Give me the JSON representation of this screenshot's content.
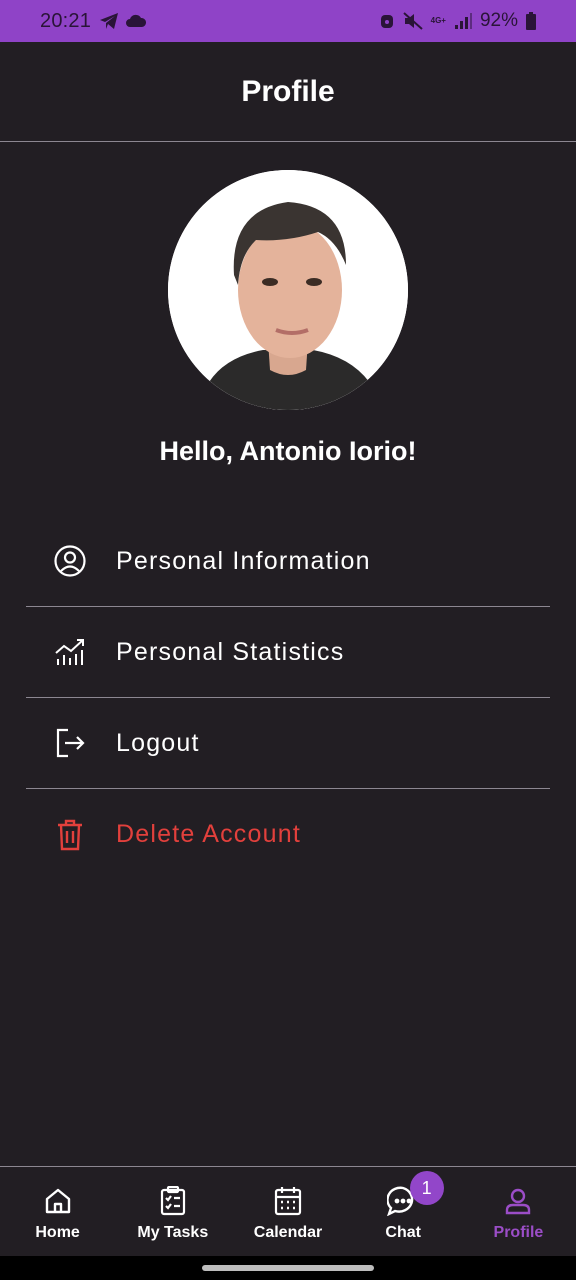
{
  "status_bar": {
    "time": "20:21",
    "network": "4G+",
    "battery": "92%",
    "left_icons": [
      "telegram-icon",
      "cloud-icon"
    ],
    "right_icons": [
      "alarm-icon",
      "mute-icon",
      "signal-icon",
      "battery-icon"
    ]
  },
  "header": {
    "title": "Profile"
  },
  "profile": {
    "greeting": "Hello, Antonio Iorio!"
  },
  "menu": {
    "items": [
      {
        "label": "Personal Information",
        "icon": "account-circle-icon"
      },
      {
        "label": "Personal Statistics",
        "icon": "statistics-icon"
      },
      {
        "label": "Logout",
        "icon": "logout-icon"
      },
      {
        "label": "Delete Account",
        "icon": "trash-icon",
        "color": "#e2403c"
      }
    ]
  },
  "bottom_nav": {
    "items": [
      {
        "label": "Home",
        "icon": "home-icon"
      },
      {
        "label": "My Tasks",
        "icon": "clipboard-icon"
      },
      {
        "label": "Calendar",
        "icon": "calendar-icon"
      },
      {
        "label": "Chat",
        "icon": "chat-icon",
        "badge": "1"
      },
      {
        "label": "Profile",
        "icon": "person-icon",
        "active": true
      }
    ]
  },
  "colors": {
    "accent": "#9b4dc7",
    "status_bar": "#8f43c7",
    "background": "#221e23",
    "danger": "#e2403c"
  }
}
